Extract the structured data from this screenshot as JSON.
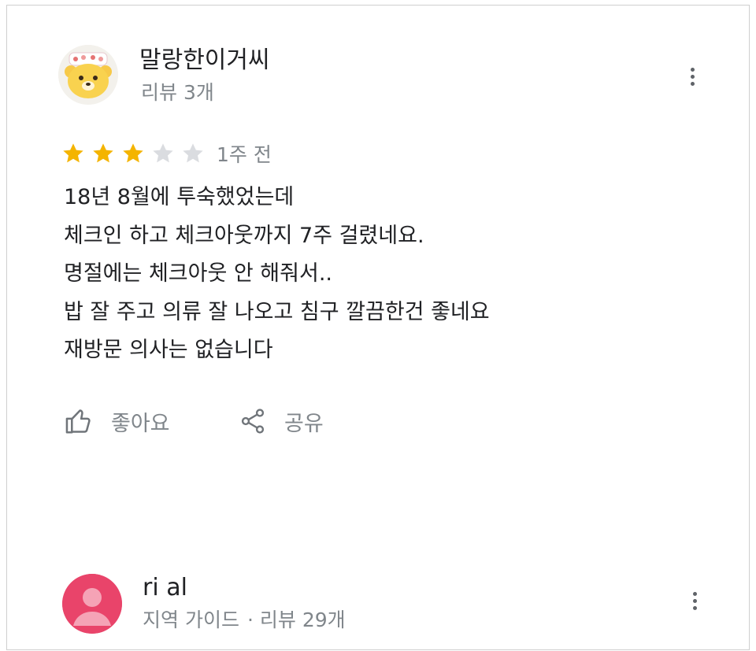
{
  "reviews": [
    {
      "author": "말랑한이거씨",
      "meta": "리뷰 3개",
      "avatar_icon": "bear-avatar",
      "rating": 3,
      "rating_max": 5,
      "time": "1주 전",
      "lines": [
        "18년 8월에 투숙했었는데",
        "체크인 하고 체크아웃까지 7주 걸렸네요.",
        "명절에는 체크아웃 안 해줘서..",
        "밥 잘 주고 의류 잘 나오고 침구 깔끔한건 좋네요",
        "재방문 의사는 없습니다"
      ],
      "actions": {
        "like_label": "좋아요",
        "share_label": "공유"
      }
    },
    {
      "author": "ri al",
      "badge": "지역 가이드",
      "separator": "·",
      "meta": "리뷰 29개",
      "avatar_icon": "person-avatar"
    }
  ],
  "colors": {
    "star_filled": "#f4b400",
    "star_empty": "#dadce0",
    "secondary_text": "#80868b",
    "avatar_pink": "#e9446a"
  }
}
